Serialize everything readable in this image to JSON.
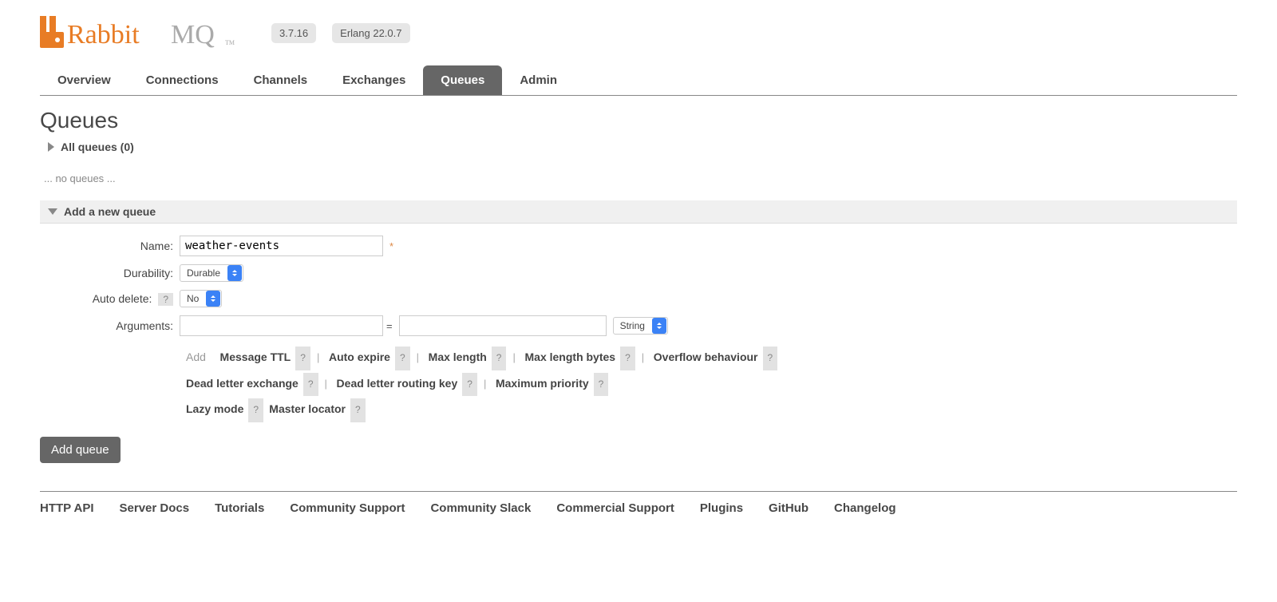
{
  "header": {
    "version": "3.7.16",
    "erlang": "Erlang 22.0.7"
  },
  "tabs": [
    "Overview",
    "Connections",
    "Channels",
    "Exchanges",
    "Queues",
    "Admin"
  ],
  "active_tab": "Queues",
  "page_title": "Queues",
  "all_queues": {
    "label": "All queues (0)"
  },
  "no_queues_text": "... no queues ...",
  "add_section": {
    "label": "Add a new queue"
  },
  "form": {
    "name_label": "Name:",
    "name_value": "weather-events",
    "durability_label": "Durability:",
    "durability_value": "Durable",
    "autodelete_label": "Auto delete:",
    "autodelete_value": "No",
    "arguments_label": "Arguments:",
    "arg_key": "",
    "arg_val": "",
    "arg_type": "String",
    "add_label": "Add",
    "shortcuts_row1": [
      "Message TTL",
      "Auto expire",
      "Max length",
      "Max length bytes",
      "Overflow behaviour"
    ],
    "shortcuts_row2": [
      "Dead letter exchange",
      "Dead letter routing key",
      "Maximum priority"
    ],
    "shortcuts_row3": [
      "Lazy mode",
      "Master locator"
    ],
    "submit_label": "Add queue"
  },
  "footer": [
    "HTTP API",
    "Server Docs",
    "Tutorials",
    "Community Support",
    "Community Slack",
    "Commercial Support",
    "Plugins",
    "GitHub",
    "Changelog"
  ]
}
